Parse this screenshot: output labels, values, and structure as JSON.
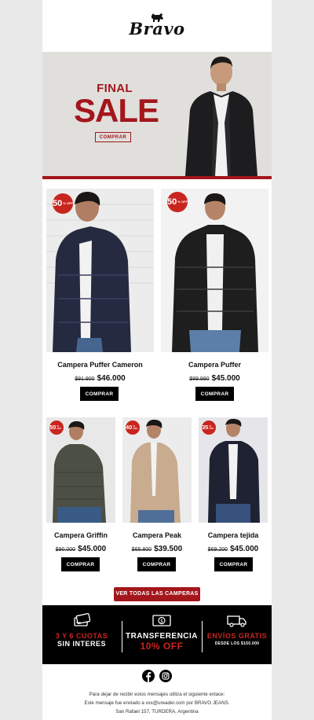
{
  "brand": {
    "name": "Bravo",
    "logo_icon": "dog-icon"
  },
  "hero": {
    "line1": "FINAL",
    "line2": "SALE",
    "button": "COMPRAR"
  },
  "products_top": [
    {
      "badge": "50",
      "badge_small": "% OFF",
      "name": "Campera Puffer Cameron",
      "old_price": "$91.900",
      "price": "$46.000",
      "button": "COMPRAR"
    },
    {
      "badge": "50",
      "badge_small": "% OFF",
      "name": "Campera Puffer",
      "old_price": "$89.990",
      "price": "$45.000",
      "button": "COMPRAR"
    }
  ],
  "products_bottom": [
    {
      "badge": "50",
      "badge_small": "% OFF",
      "name": "Campera Griffin",
      "old_price": "$90.000",
      "price": "$45.000",
      "button": "COMPRAR"
    },
    {
      "badge": "40",
      "badge_small": "% OFF",
      "name": "Campera Peak",
      "old_price": "$65.800",
      "price": "$39.500",
      "button": "COMPRAR"
    },
    {
      "badge": "35",
      "badge_small": "% OFF",
      "name": "Campera tejida",
      "old_price": "$69.200",
      "price": "$45.000",
      "button": "COMPRAR"
    }
  ],
  "see_all": "VER TODAS LAS CAMPERAS",
  "benefits": [
    {
      "icon": "credit-cards-icon",
      "line1": "3 Y 6 CUOTAS",
      "line2": "SIN INTERES",
      "line3": ""
    },
    {
      "icon": "money-icon",
      "line1": "TRANSFERENCIA",
      "line2": "10% OFF",
      "line3": ""
    },
    {
      "icon": "truck-icon",
      "line1": "ENVÍOS GRATIS",
      "line2": "",
      "line3": "DESDE LOS $150.000"
    }
  ],
  "colors": {
    "accent": "#a3161b",
    "badge": "#c9251f",
    "dark": "#000000"
  },
  "footer": {
    "line1": "Para dejar de recibir estos mensajes utiliza el siguiente enlace:",
    "line2": "Este mensaje fue enviado a xxx@ureader.com por BRAVO JEANS.",
    "line3": "San Rafael 157, TURDERA, Argentina",
    "social": [
      "facebook-icon",
      "instagram-icon"
    ]
  }
}
